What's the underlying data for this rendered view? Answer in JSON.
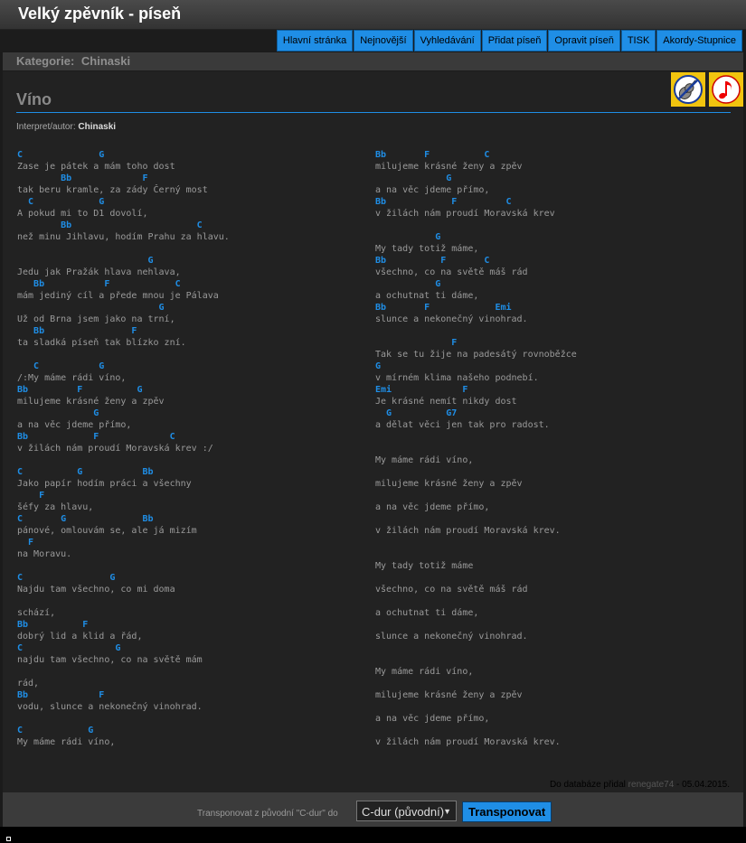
{
  "app": {
    "title": "Velký zpěvník - píseň"
  },
  "nav": [
    "Hlavní stránka",
    "Nejnovější",
    "Vyhledávání",
    "Přidat píseň",
    "Opravit píseň",
    "TISK",
    "Akordy-Stupnice"
  ],
  "category": {
    "label": "Kategorie:",
    "value": "Chinaski"
  },
  "song": {
    "title": "Víno",
    "author_label": "Interpret/autor:",
    "author": "Chinaski"
  },
  "icons": {
    "guitar": "guitar-icon",
    "note": "music-note-icon"
  },
  "colors": {
    "accent": "#1f8ee6",
    "chord": "#1f8ee6",
    "icon_bg": "#f1c40f"
  },
  "lyrics_left": [
    {
      "t": "c",
      "s": "C              G"
    },
    {
      "t": "l",
      "s": "Zase je pátek a mám toho dost"
    },
    {
      "t": "c",
      "s": "        Bb             F"
    },
    {
      "t": "l",
      "s": "tak beru kramle, za zády Černý most"
    },
    {
      "t": "c",
      "s": "  C            G"
    },
    {
      "t": "l",
      "s": "A pokud mi to D1 dovolí,"
    },
    {
      "t": "c",
      "s": "        Bb                       C"
    },
    {
      "t": "l",
      "s": "než minu Jihlavu, hodím Prahu za hlavu."
    },
    {
      "t": "l",
      "s": ""
    },
    {
      "t": "c",
      "s": "                        G"
    },
    {
      "t": "l",
      "s": "Jedu jak Pražák hlava nehlava,"
    },
    {
      "t": "c",
      "s": "   Bb           F            C"
    },
    {
      "t": "l",
      "s": "mám jediný cíl a přede mnou je Pálava"
    },
    {
      "t": "c",
      "s": "                          G"
    },
    {
      "t": "l",
      "s": "Už od Brna jsem jako na trní,"
    },
    {
      "t": "c",
      "s": "   Bb                F"
    },
    {
      "t": "l",
      "s": "ta sladká píseň tak blízko zní."
    },
    {
      "t": "l",
      "s": ""
    },
    {
      "t": "c",
      "s": "   C           G"
    },
    {
      "t": "l",
      "s": "/:My máme rádi víno,"
    },
    {
      "t": "c",
      "s": "Bb         F          G"
    },
    {
      "t": "l",
      "s": "milujeme krásné ženy a zpěv"
    },
    {
      "t": "c",
      "s": "              G"
    },
    {
      "t": "l",
      "s": "a na věc jdeme přímo,"
    },
    {
      "t": "c",
      "s": "Bb            F             C"
    },
    {
      "t": "l",
      "s": "v žilách nám proudí Moravská krev :/"
    },
    {
      "t": "l",
      "s": ""
    },
    {
      "t": "c",
      "s": "C          G           Bb"
    },
    {
      "t": "l",
      "s": "Jako papír hodím práci a všechny"
    },
    {
      "t": "c",
      "s": "    F"
    },
    {
      "t": "l",
      "s": "šéfy za hlavu,"
    },
    {
      "t": "c",
      "s": "C       G              Bb"
    },
    {
      "t": "l",
      "s": "pánové, omlouvám se, ale já mizím"
    },
    {
      "t": "c",
      "s": "  F"
    },
    {
      "t": "l",
      "s": "na Moravu."
    },
    {
      "t": "l",
      "s": ""
    },
    {
      "t": "c",
      "s": "C                G"
    },
    {
      "t": "l",
      "s": "Najdu tam všechno, co mi doma"
    },
    {
      "t": "l",
      "s": ""
    },
    {
      "t": "l",
      "s": "schází,"
    },
    {
      "t": "c",
      "s": "Bb          F"
    },
    {
      "t": "l",
      "s": "dobrý lid a klid a řád,"
    },
    {
      "t": "c",
      "s": "C                 G"
    },
    {
      "t": "l",
      "s": "najdu tam všechno, co na světě mám"
    },
    {
      "t": "l",
      "s": ""
    },
    {
      "t": "l",
      "s": "rád,"
    },
    {
      "t": "c",
      "s": "Bb             F"
    },
    {
      "t": "l",
      "s": "vodu, slunce a nekonečný vinohrad."
    },
    {
      "t": "l",
      "s": ""
    },
    {
      "t": "c",
      "s": "C            G"
    },
    {
      "t": "l",
      "s": "My máme rádi víno,"
    }
  ],
  "lyrics_right": [
    {
      "t": "c",
      "s": "Bb       F          C"
    },
    {
      "t": "l",
      "s": "milujeme krásné ženy a zpěv"
    },
    {
      "t": "c",
      "s": "             G"
    },
    {
      "t": "l",
      "s": "a na věc jdeme přímo,"
    },
    {
      "t": "c",
      "s": "Bb            F         C"
    },
    {
      "t": "l",
      "s": "v žilách nám proudí Moravská krev"
    },
    {
      "t": "l",
      "s": ""
    },
    {
      "t": "c",
      "s": "           G"
    },
    {
      "t": "l",
      "s": "My tady totiž máme,"
    },
    {
      "t": "c",
      "s": "Bb          F       C"
    },
    {
      "t": "l",
      "s": "všechno, co na světě máš rád"
    },
    {
      "t": "c",
      "s": "           G"
    },
    {
      "t": "l",
      "s": "a ochutnat ti dáme,"
    },
    {
      "t": "c",
      "s": "Bb       F            Emi"
    },
    {
      "t": "l",
      "s": "slunce a nekonečný vinohrad."
    },
    {
      "t": "l",
      "s": ""
    },
    {
      "t": "c",
      "s": "              F"
    },
    {
      "t": "l",
      "s": "Tak se tu žije na padesátý rovnoběžce"
    },
    {
      "t": "c",
      "s": "G"
    },
    {
      "t": "l",
      "s": "v mírném klima našeho podnebí."
    },
    {
      "t": "c",
      "s": "Emi             F"
    },
    {
      "t": "l",
      "s": "Je krásné nemít nikdy dost"
    },
    {
      "t": "c",
      "s": "  G          G7"
    },
    {
      "t": "l",
      "s": "a dělat věci jen tak pro radost."
    },
    {
      "t": "l",
      "s": ""
    },
    {
      "t": "l",
      "s": ""
    },
    {
      "t": "l",
      "s": "My máme rádi víno,"
    },
    {
      "t": "l",
      "s": ""
    },
    {
      "t": "l",
      "s": "milujeme krásné ženy a zpěv"
    },
    {
      "t": "l",
      "s": ""
    },
    {
      "t": "l",
      "s": "a na věc jdeme přímo,"
    },
    {
      "t": "l",
      "s": ""
    },
    {
      "t": "l",
      "s": "v žilách nám proudí Moravská krev."
    },
    {
      "t": "l",
      "s": ""
    },
    {
      "t": "l",
      "s": ""
    },
    {
      "t": "l",
      "s": "My tady totiž máme"
    },
    {
      "t": "l",
      "s": ""
    },
    {
      "t": "l",
      "s": "všechno, co na světě máš rád"
    },
    {
      "t": "l",
      "s": ""
    },
    {
      "t": "l",
      "s": "a ochutnat ti dáme,"
    },
    {
      "t": "l",
      "s": ""
    },
    {
      "t": "l",
      "s": "slunce a nekonečný vinohrad."
    },
    {
      "t": "l",
      "s": ""
    },
    {
      "t": "l",
      "s": ""
    },
    {
      "t": "l",
      "s": "My máme rádi víno,"
    },
    {
      "t": "l",
      "s": ""
    },
    {
      "t": "l",
      "s": "milujeme krásné ženy a zpěv"
    },
    {
      "t": "l",
      "s": ""
    },
    {
      "t": "l",
      "s": "a na věc jdeme přímo,"
    },
    {
      "t": "l",
      "s": ""
    },
    {
      "t": "l",
      "s": "v žilách nám proudí Moravská krev."
    }
  ],
  "added": {
    "label": "Do databáze přidal",
    "user": "renegate74",
    "date": " - 05.04.2015",
    "end": "."
  },
  "transpose": {
    "label": "Transponovat z původní \"C-dur\" do",
    "selected": "C-dur (původní)",
    "button": "Transponovat"
  }
}
